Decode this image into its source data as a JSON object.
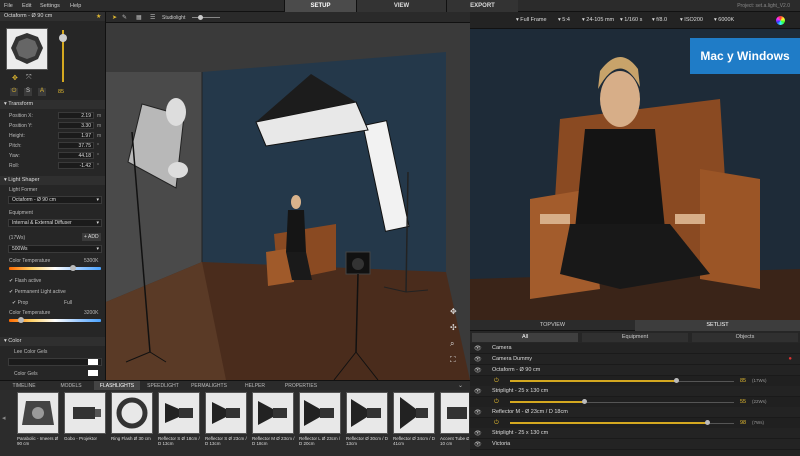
{
  "menu": {
    "items": [
      "File",
      "Edit",
      "Settings",
      "Help"
    ]
  },
  "modes": {
    "setup": "SETUP",
    "view": "VIEW",
    "export": "EXPORT"
  },
  "project_title": "Project: set.a.light_V2.0",
  "left": {
    "object_title": "Octaform - Ø 90 cm",
    "power_value": "85",
    "transform_title": "Transform",
    "transform": [
      {
        "label": "Position X:",
        "value": "2.19",
        "unit": "m"
      },
      {
        "label": "Position Y:",
        "value": "3.30",
        "unit": "m"
      },
      {
        "label": "Height:",
        "value": "1.97",
        "unit": "m"
      },
      {
        "label": "Pitch:",
        "value": "37.75",
        "unit": "°"
      },
      {
        "label": "Yaw:",
        "value": "44.18",
        "unit": "°"
      },
      {
        "label": "Roll:",
        "value": "-1.42",
        "unit": "°"
      }
    ],
    "light_shaper_title": "Light Shaper",
    "light_former_label": "Light Former",
    "light_former_value": "Octaform - Ø 90 cm",
    "equipment_label": "Equipment",
    "equipment_value": "Internal & External Diffuser",
    "equipment_count": "(17Ws)",
    "add_label": "+ ADD",
    "ws_value": "500Ws",
    "color_temp_label": "Color Temperature",
    "color_temp_value": "5300K",
    "flash_active": "Flash active",
    "permanent_light": "Permanent Light active",
    "prop_label": "Prop",
    "full_label": "Full",
    "color_temp_2_value": "3200K",
    "color_title": "Color",
    "lee_gels": "Lee Color Gels",
    "color_gels": "Color Gels"
  },
  "viewport": {
    "studiolight_label": "Studiolight"
  },
  "camera": {
    "frame": "Full Frame",
    "ratio": "5:4",
    "lens": "24-105 mm",
    "shutter": "1/160 s",
    "aperture": "f/8.0",
    "iso": "ISO200",
    "wb": "6000K",
    "banner": "Mac y Windows"
  },
  "setlist": {
    "tab_topview": "TOPVIEW",
    "tab_setlist": "SETLIST",
    "sub_all": "All",
    "sub_equipment": "Equipment",
    "sub_objects": "Objects",
    "rows": [
      {
        "name": "Camera"
      },
      {
        "name": "Camera Dummy"
      },
      {
        "name": "Octaform - Ø 90 cm",
        "value": "85",
        "sub": "(17Ws)",
        "fill": 0.74
      },
      {
        "name": "Striplight - 25 x 130 cm",
        "value": "55",
        "sub": "(22Ws)",
        "fill": 0.33
      },
      {
        "name": "Reflector M - Ø 23cm / D 18cm",
        "value": "98",
        "sub": "(7Ws)",
        "fill": 0.88
      },
      {
        "name": "Striplight - 25 x 130 cm"
      },
      {
        "name": "Victoria"
      }
    ]
  },
  "bottom_tabs": [
    "TIMELINE",
    "MODELS",
    "FLASHLIGHTS",
    "SPEEDLIGHT",
    "PERMALIGHTS",
    "HELPER",
    "PROPERTIES"
  ],
  "library": [
    {
      "name": "Parabolic - Imeers Ø 90 cm"
    },
    {
      "name": "Gobo - Projektor"
    },
    {
      "name": "Ring Flash Ø 30 cm"
    },
    {
      "name": "Reflector S Ø 18cm / D 13cm"
    },
    {
      "name": "Reflector S Ø 23cm / D 13cm"
    },
    {
      "name": "Reflector M Ø 23cm / D 18cm"
    },
    {
      "name": "Reflector L Ø 23cm / D 20cm"
    },
    {
      "name": "Reflector Ø 30cm / D 13cm"
    },
    {
      "name": "Reflector Ø 34cm / D 41cm"
    },
    {
      "name": "Accent Tube Ø 10 cm"
    }
  ]
}
